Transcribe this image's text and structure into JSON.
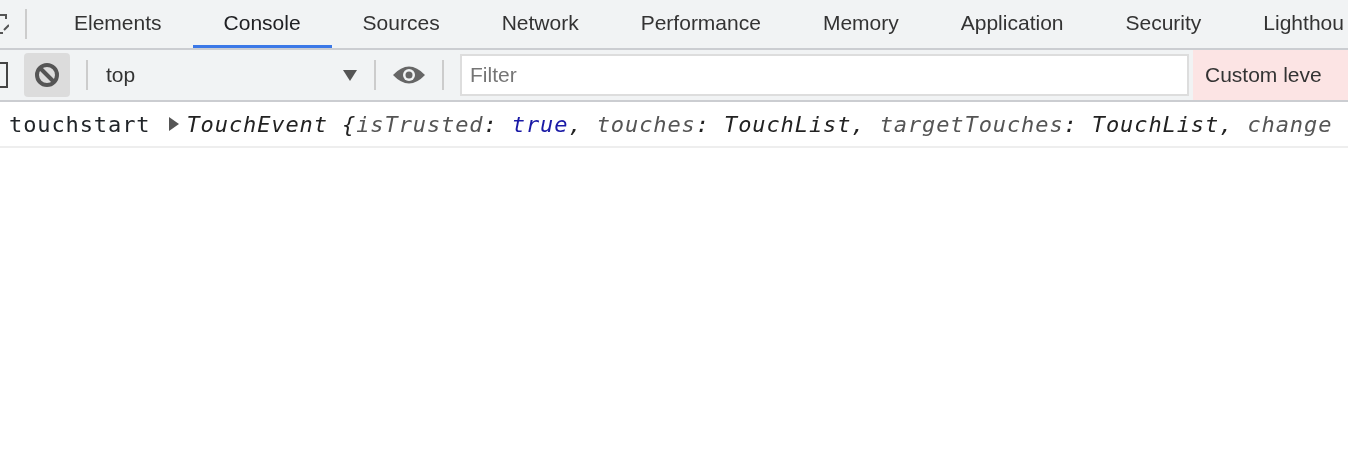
{
  "tabs": [
    {
      "label": "Elements",
      "selected": false
    },
    {
      "label": "Console",
      "selected": true
    },
    {
      "label": "Sources",
      "selected": false
    },
    {
      "label": "Network",
      "selected": false
    },
    {
      "label": "Performance",
      "selected": false
    },
    {
      "label": "Memory",
      "selected": false
    },
    {
      "label": "Application",
      "selected": false
    },
    {
      "label": "Security",
      "selected": false
    },
    {
      "label": "Lighthou",
      "selected": false
    }
  ],
  "toolbar": {
    "context": "top",
    "filter": {
      "placeholder": "Filter"
    },
    "levels": "Custom leve"
  },
  "messages": [
    {
      "text": "touchstart",
      "expanded": false,
      "preview": [
        {
          "kind": "value",
          "text": "TouchEvent {"
        },
        {
          "kind": "key",
          "text": "isTrusted"
        },
        {
          "kind": "punct",
          "text": ": "
        },
        {
          "kind": "bool",
          "text": "true"
        },
        {
          "kind": "punct",
          "text": ", "
        },
        {
          "kind": "key",
          "text": "touches"
        },
        {
          "kind": "punct",
          "text": ": "
        },
        {
          "kind": "value",
          "text": "TouchList"
        },
        {
          "kind": "punct",
          "text": ", "
        },
        {
          "kind": "key",
          "text": "targetTouches"
        },
        {
          "kind": "punct",
          "text": ": "
        },
        {
          "kind": "value",
          "text": "TouchList"
        },
        {
          "kind": "punct",
          "text": ", "
        },
        {
          "kind": "key",
          "text": "change"
        }
      ]
    }
  ]
}
